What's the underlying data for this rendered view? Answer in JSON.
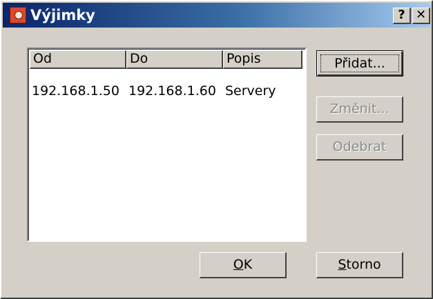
{
  "window": {
    "title": "Výjimky",
    "help_label": "?",
    "close_label": "✕"
  },
  "list": {
    "columns": [
      "Od",
      "Do",
      "Popis"
    ],
    "rows": [
      {
        "od": "192.168.1.50",
        "do": "192.168.1.60",
        "popis": "Servery"
      }
    ]
  },
  "buttons": {
    "add": "Přidat...",
    "edit": "Změnit...",
    "remove": "Odebrat",
    "ok_mnemonic": "O",
    "ok_rest": "K",
    "cancel_mnemonic": "S",
    "cancel_rest": "torno"
  }
}
